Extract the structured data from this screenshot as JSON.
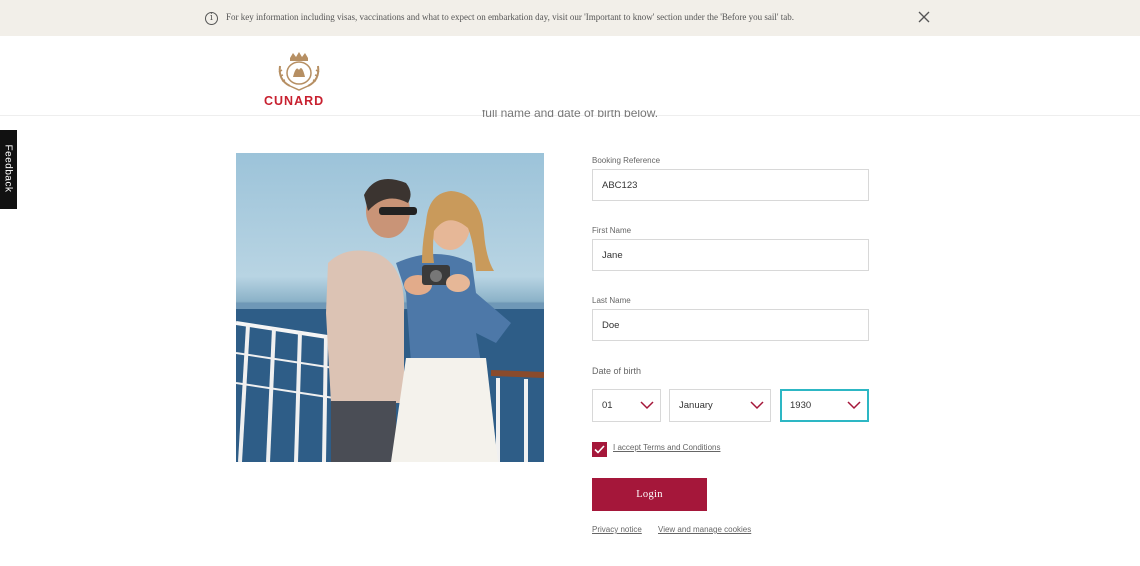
{
  "banner": {
    "info_icon": "info-icon",
    "message": "For key information including visas, vaccinations and what to expect on embarkation day, visit our 'Important to know' section under the 'Before you sail' tab.",
    "close_icon": "close-icon"
  },
  "header": {
    "logo_text": "CUNARD",
    "brand_color": "#c8202f"
  },
  "intro": {
    "subtitle": "full name and date of birth below."
  },
  "feedback": {
    "label": "Feedback"
  },
  "form": {
    "booking_reference": {
      "label": "Booking Reference",
      "value": "ABC123"
    },
    "first_name": {
      "label": "First Name",
      "value": "Jane"
    },
    "last_name": {
      "label": "Last Name",
      "value": "Doe"
    },
    "date_of_birth": {
      "label": "Date of birth",
      "day": "01",
      "month": "January",
      "year": "1930"
    },
    "accept_terms": {
      "checked": true,
      "label": "I accept Terms and Conditions"
    },
    "login_label": "Login",
    "accent_color": "#a5173a"
  },
  "footer": {
    "privacy": "Privacy notice",
    "cookies": "View and manage cookies"
  }
}
